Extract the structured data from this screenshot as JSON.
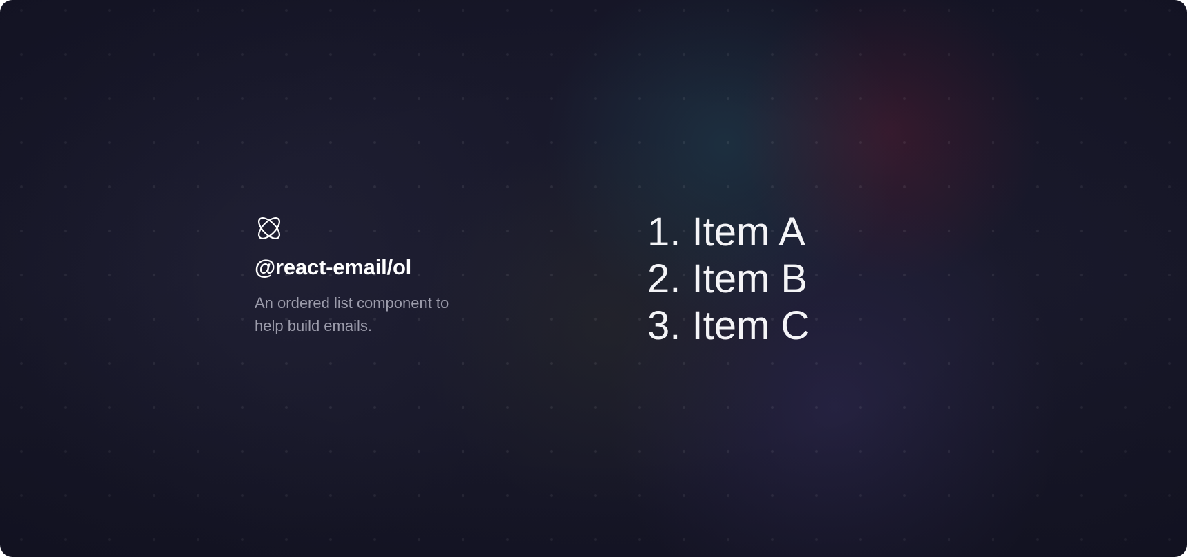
{
  "component": {
    "name": "@react-email/ol",
    "description": "An ordered list component to help build emails.",
    "logo_icon": "atom-icon"
  },
  "list": {
    "items": [
      "1. Item A",
      "2. Item B",
      "3. Item C"
    ]
  },
  "colors": {
    "background": "#17172a",
    "title": "#ffffff",
    "description": "#9c9cab",
    "list_text": "#f4f4f7"
  }
}
